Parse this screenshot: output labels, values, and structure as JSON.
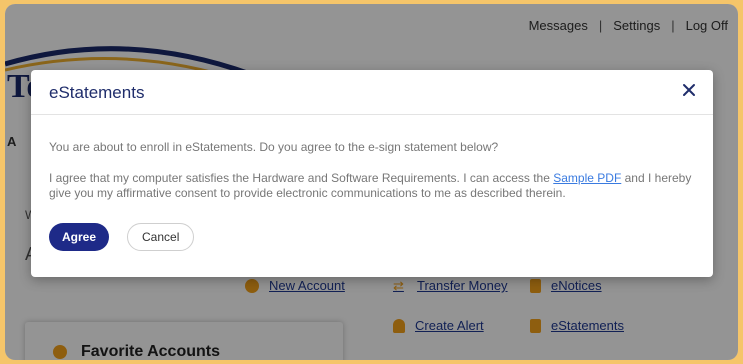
{
  "header": {
    "messages_label": "Messages",
    "settings_label": "Settings",
    "logoff_label": "Log Off",
    "separator": "|"
  },
  "logo": {
    "text": "Te"
  },
  "background_fragments": {
    "nav_text": "A",
    "side_text_1": "W",
    "side_text_2": "A"
  },
  "quick_actions": {
    "new_account": "New Account",
    "transfer_money": "Transfer Money",
    "enotices": "eNotices",
    "create_alert": "Create Alert",
    "estatements": "eStatements"
  },
  "favorites": {
    "title": "Favorite Accounts"
  },
  "modal": {
    "title": "eStatements",
    "prompt": "You are about to enroll in eStatements. Do you agree to the e-sign statement below?",
    "agreement_before": "I agree that my computer satisfies the Hardware and Software Requirements. I can access the ",
    "sample_link": "Sample PDF",
    "agreement_after": " and I hereby give you my affirmative consent to provide electronic communications to me as described therein.",
    "agree_label": "Agree",
    "cancel_label": "Cancel"
  },
  "colors": {
    "frame_background": "#f5c56a",
    "primary": "#1e2a88",
    "link": "#3a7be0",
    "accent_icon": "#f4a21a"
  }
}
